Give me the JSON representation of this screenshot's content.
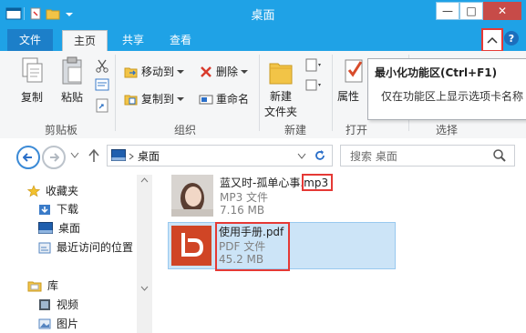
{
  "window": {
    "title": "桌面",
    "minimize_glyph": "—",
    "maximize_glyph": "□",
    "close_glyph": "✕"
  },
  "tabs": [
    {
      "label": "文件"
    },
    {
      "label": "主页"
    },
    {
      "label": "共享"
    },
    {
      "label": "查看"
    }
  ],
  "ribbon": {
    "copy": "复制",
    "paste": "粘贴",
    "clipboard_group": "剪贴板",
    "move_to": "移动到",
    "copy_to": "复制到",
    "delete": "删除",
    "rename": "重命名",
    "organize_group": "组织",
    "new_folder_line1": "新建",
    "new_folder_line2": "文件夹",
    "new_group": "新建",
    "properties": "属性",
    "open_group": "打开",
    "select_group": "选择"
  },
  "tooltip": {
    "title": "最小化功能区(Ctrl+F1)",
    "description": "仅在功能区上显示选项卡名称"
  },
  "address": {
    "location": "桌面",
    "search_placeholder": "搜索 桌面"
  },
  "nav": {
    "favorites": "收藏夹",
    "downloads": "下载",
    "desktop": "桌面",
    "recent": "最近访问的位置",
    "libraries": "库",
    "videos": "视频",
    "pictures": "图片"
  },
  "files": [
    {
      "name_main": "蓝又时-孤单心事",
      "name_ext": ".mp3",
      "type": "MP3 文件",
      "size": "7.16 MB"
    },
    {
      "name": "使用手册.pdf",
      "type": "PDF 文件",
      "size": "45.2 MB"
    }
  ],
  "colors": {
    "titlebar": "#1fa2e6",
    "file_tab": "#1c7fc9",
    "highlight": "#e53935",
    "selection": "#cce4f7"
  }
}
